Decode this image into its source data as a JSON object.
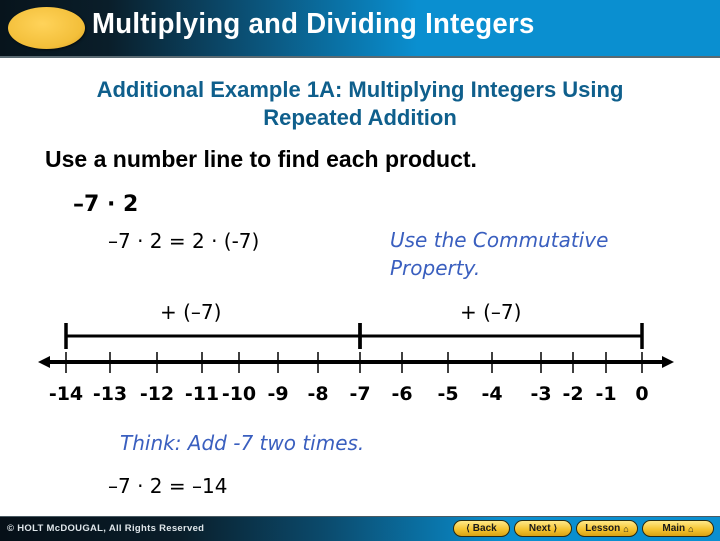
{
  "header": {
    "title": "Multiplying and Dividing Integers"
  },
  "subtitle": {
    "line1": "Additional Example 1A: Multiplying Integers Using",
    "line2": "Repeated Addition"
  },
  "instruction": "Use a number line to find each product.",
  "problem": "–7 · 2",
  "equation": "–7 · 2 = 2 · (-7)",
  "hint": {
    "line1": "Use the Commutative",
    "line2": "Property."
  },
  "number_line": {
    "segments": [
      {
        "label": "+ (–7)",
        "from": -14,
        "to": -7
      },
      {
        "label": "+ (–7)",
        "from": -7,
        "to": 0
      }
    ],
    "ticks": [
      {
        "value": -14,
        "label": "-14"
      },
      {
        "value": -13,
        "label": "-13"
      },
      {
        "value": -12,
        "label": "-12"
      },
      {
        "value": -11,
        "label": "-11"
      },
      {
        "value": -10,
        "label": "-10"
      },
      {
        "value": -9,
        "label": "-9"
      },
      {
        "value": -8,
        "label": "-8"
      },
      {
        "value": -7,
        "label": "-7"
      },
      {
        "value": -6,
        "label": "-6"
      },
      {
        "value": -5,
        "label": "-5"
      },
      {
        "value": -4,
        "label": "-4"
      },
      {
        "value": -3,
        "label": "-3"
      },
      {
        "value": -2,
        "label": "-2"
      },
      {
        "value": -1,
        "label": "-1"
      },
      {
        "value": 0,
        "label": "0"
      }
    ]
  },
  "think": "Think: Add -7 two times.",
  "answer": "–7 · 2 = –14",
  "footer": {
    "copyright": "© HOLT McDOUGAL, All Rights Reserved",
    "buttons": [
      {
        "label": "Back",
        "icon": "chevron-left-icon"
      },
      {
        "label": "Next",
        "icon": "chevron-right-icon"
      },
      {
        "label": "Lesson",
        "icon": "home-icon"
      },
      {
        "label": "Main",
        "icon": "home-icon"
      }
    ]
  }
}
